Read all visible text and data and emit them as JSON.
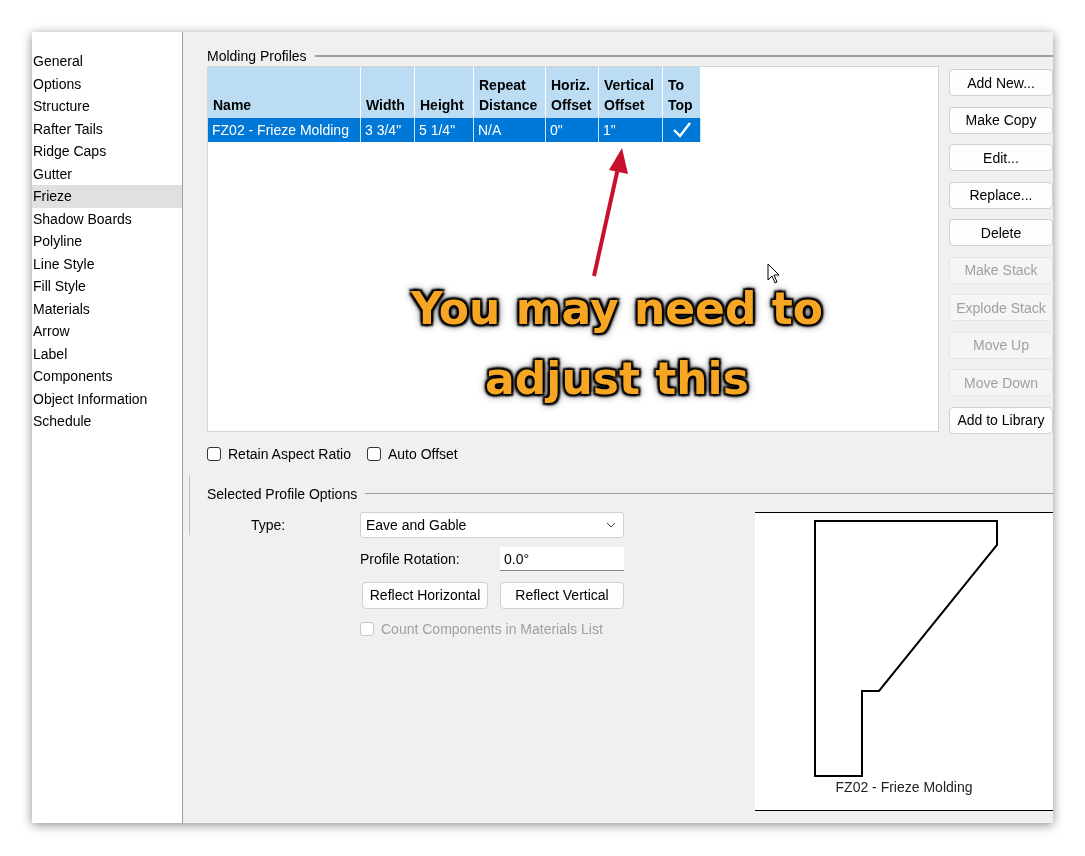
{
  "sidebar": {
    "items": [
      {
        "label": "General",
        "selected": false
      },
      {
        "label": "Options",
        "selected": false
      },
      {
        "label": "Structure",
        "selected": false
      },
      {
        "label": "Rafter Tails",
        "selected": false
      },
      {
        "label": "Ridge Caps",
        "selected": false
      },
      {
        "label": "Gutter",
        "selected": false
      },
      {
        "label": "Frieze",
        "selected": true
      },
      {
        "label": "Shadow Boards",
        "selected": false
      },
      {
        "label": "Polyline",
        "selected": false
      },
      {
        "label": "Line Style",
        "selected": false
      },
      {
        "label": "Fill Style",
        "selected": false
      },
      {
        "label": "Materials",
        "selected": false
      },
      {
        "label": "Arrow",
        "selected": false
      },
      {
        "label": "Label",
        "selected": false
      },
      {
        "label": "Components",
        "selected": false
      },
      {
        "label": "Object Information",
        "selected": false
      },
      {
        "label": "Schedule",
        "selected": false
      }
    ]
  },
  "molding_profiles": {
    "title": "Molding Profiles",
    "table": {
      "columns": [
        "Name",
        "Width",
        "Height",
        "Repeat Distance",
        "Horiz. Offset",
        "Vertical Offset",
        "To Top"
      ],
      "rows": [
        {
          "selected": true,
          "cells": [
            "FZ02 - Frieze Molding",
            "3 3/4\"",
            "5 1/4\"",
            "N/A",
            "0\"",
            "1\""
          ],
          "to_top": true
        }
      ]
    },
    "buttons": [
      {
        "label": "Add New...",
        "disabled": false
      },
      {
        "label": "Make Copy",
        "disabled": false
      },
      {
        "label": "Edit...",
        "disabled": false
      },
      {
        "label": "Replace...",
        "disabled": false
      },
      {
        "label": "Delete",
        "disabled": false
      },
      {
        "label": "Make Stack",
        "disabled": true
      },
      {
        "label": "Explode Stack",
        "disabled": true
      },
      {
        "label": "Move Up",
        "disabled": true
      },
      {
        "label": "Move Down",
        "disabled": true
      },
      {
        "label": "Add to Library",
        "disabled": false
      }
    ],
    "checkboxes": [
      {
        "label": "Retain Aspect Ratio",
        "checked": false
      },
      {
        "label": "Auto Offset",
        "checked": false
      }
    ]
  },
  "selected_profile_options": {
    "title": "Selected Profile Options",
    "type_label": "Type:",
    "type_value": "Eave and Gable",
    "rotation_label": "Profile Rotation:",
    "rotation_value": "0.0°",
    "buttons": [
      "Reflect Horizontal",
      "Reflect Vertical"
    ],
    "count_components": {
      "label": "Count Components in Materials List",
      "checked": false,
      "disabled": true
    },
    "preview": {
      "caption": "FZ02 - Frieze Molding"
    }
  },
  "annotation": {
    "lines": [
      "You may need to",
      "adjust this"
    ]
  }
}
